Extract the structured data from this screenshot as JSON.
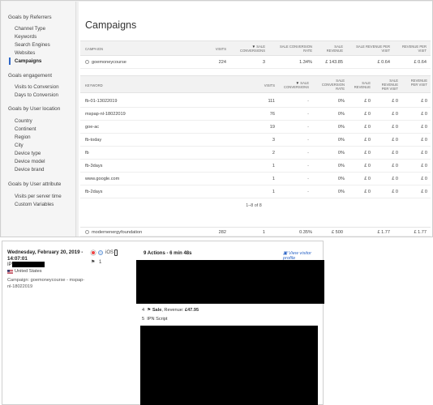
{
  "sidebar": {
    "groups": [
      {
        "title": "Goals by Referrers",
        "items": [
          "Channel Type",
          "Keywords",
          "Search Engines",
          "Websites",
          "Campaigns"
        ],
        "active": "Campaigns"
      },
      {
        "title": "Goals engagement",
        "items": [
          "Visits to Conversion",
          "Days to Conversion"
        ]
      },
      {
        "title": "Goals by User location",
        "items": [
          "Country",
          "Continent",
          "Region",
          "City",
          "Device type",
          "Device model",
          "Device brand"
        ]
      },
      {
        "title": "Goals by User attribute",
        "items": [
          "Visits per server time",
          "Custom Variables"
        ]
      }
    ]
  },
  "page_title": "Campaigns",
  "campaign_table": {
    "headers": [
      "CAMPAIGN",
      "VISITS",
      "SALE CONVERSIONS",
      "SALE CONVERSION RATE",
      "SALE REVENUE",
      "SALE REVENUE PER VISIT",
      "REVENUE PER VISIT"
    ],
    "sorted_column": "SALE CONVERSIONS",
    "rows": [
      [
        "goemoneycourse",
        "224",
        "3",
        "1.34%",
        "£ 143.85",
        "£ 0.64",
        "£ 0.64"
      ],
      [
        "modernenergyfoundation",
        "282",
        "1",
        "0.35%",
        "£ 500",
        "£ 1.77",
        "£ 1.77"
      ]
    ]
  },
  "keyword_table": {
    "headers": [
      "KEYWORD",
      "VISITS",
      "SALE CONVERSIONS",
      "SALE CONVERSION RATE",
      "SALE REVENUE",
      "SALE REVENUE PER VISIT",
      "REVENUE PER VISIT"
    ],
    "sorted_column": "SALE CONVERSIONS",
    "rows": [
      [
        "fb-01-13022019",
        "111",
        "-",
        "0%",
        "£ 0",
        "£ 0",
        "£ 0"
      ],
      [
        "mspap-nl-18022019",
        "76",
        "-",
        "0%",
        "£ 0",
        "£ 0",
        "£ 0"
      ],
      [
        "goe-ac",
        "19",
        "-",
        "0%",
        "£ 0",
        "£ 0",
        "£ 0"
      ],
      [
        "fb-today",
        "3",
        "-",
        "0%",
        "£ 0",
        "£ 0",
        "£ 0"
      ],
      [
        "fb",
        "2",
        "-",
        "0%",
        "£ 0",
        "£ 0",
        "£ 0"
      ],
      [
        "fb-3days",
        "1",
        "-",
        "0%",
        "£ 0",
        "£ 0",
        "£ 0"
      ],
      [
        "www.google.com",
        "1",
        "-",
        "0%",
        "£ 0",
        "£ 0",
        "£ 0"
      ],
      [
        "fb-2days",
        "1",
        "-",
        "0%",
        "£ 0",
        "£ 0",
        "£ 0"
      ]
    ],
    "pagination": "1–8 of 8"
  },
  "visitor_log": {
    "date": "Wednesday, February 20, 2019 - 14:07:01",
    "ip_label": "IP",
    "country": "United States",
    "campaign": "Campaign: goemoneycourse - mspap-nl-18022019",
    "os_label": "iOS",
    "goal_count": "1",
    "actions_title": "9 Actions - 6 min 48s",
    "view_profile": "View visitor profile",
    "action4_num": "4",
    "action4_label": "Sale",
    "action4_revenue_label": ", Revenue:",
    "action4_revenue": "£47.95",
    "action5_num": "5",
    "action5_label": "IPN Script"
  },
  "icons": [
    "campaign-globe-icon",
    "browser-icon",
    "os-icon",
    "device-icon",
    "goal-flag-icon",
    "us-flag-icon",
    "sale-flag-icon"
  ],
  "colors": {
    "accent": "#2f67c7",
    "sidebar_bg": "#f5f5f5",
    "redaction": "#000000"
  }
}
